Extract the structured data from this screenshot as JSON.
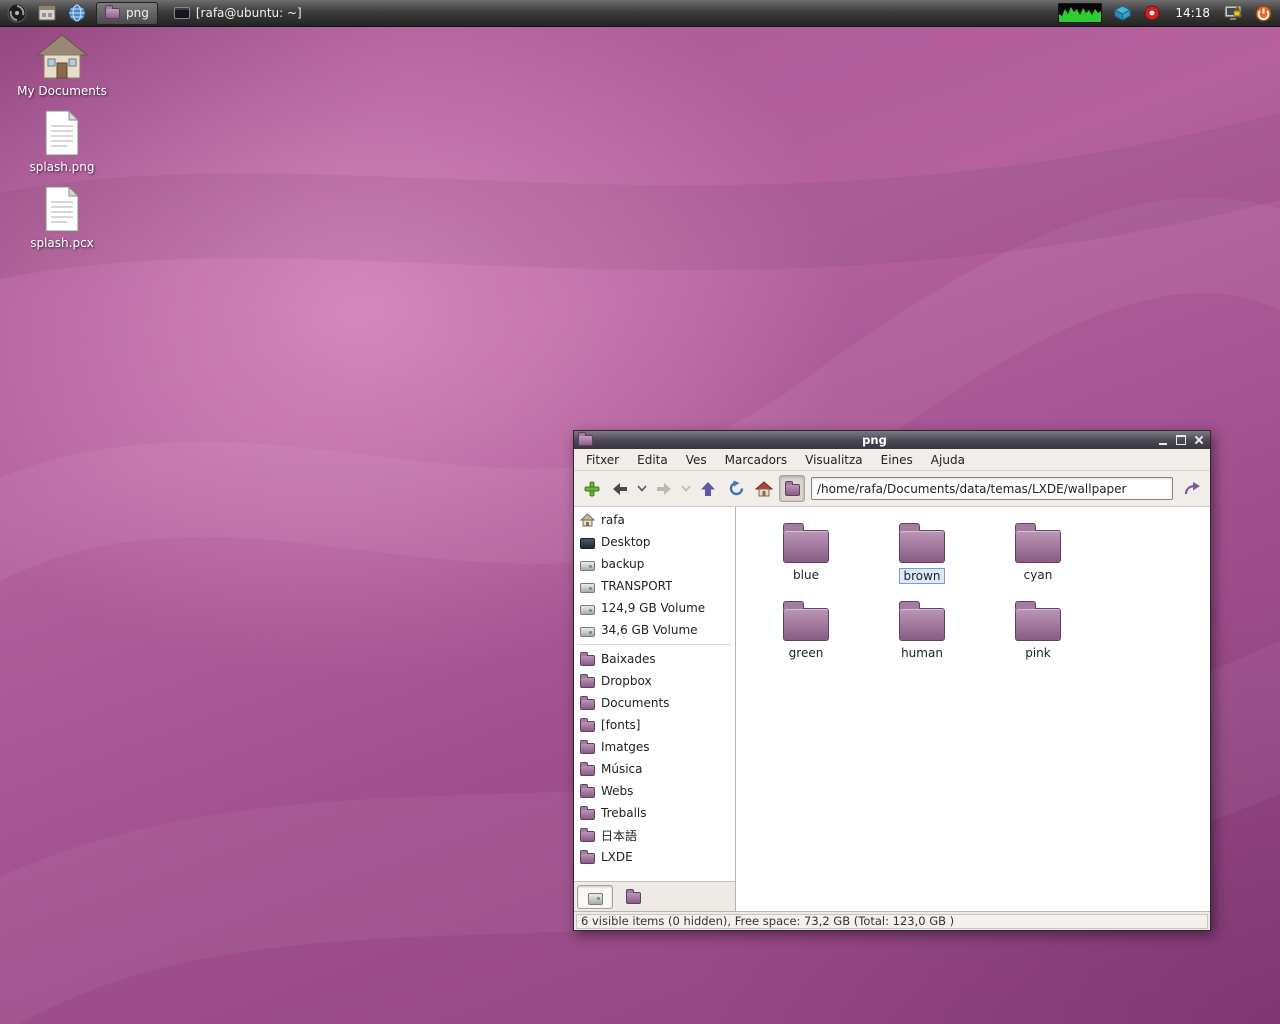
{
  "panel": {
    "tasks": [
      {
        "label": "png"
      },
      {
        "label": "[rafa@ubuntu: ~]"
      }
    ],
    "clock": "14:18"
  },
  "desktop": {
    "icons": [
      {
        "label": "My Documents"
      },
      {
        "label": "splash.png"
      },
      {
        "label": "splash.pcx"
      }
    ]
  },
  "window": {
    "title": "png",
    "menu": [
      "Fitxer",
      "Edita",
      "Ves",
      "Marcadors",
      "Visualitza",
      "Eines",
      "Ajuda"
    ],
    "toolbar": {
      "address": "/home/rafa/Documents/data/temas/LXDE/wallpaper"
    },
    "sidebar": {
      "places": [
        "rafa",
        "Desktop",
        "backup",
        "TRANSPORT",
        "124,9 GB Volume",
        "34,6 GB Volume"
      ],
      "folders": [
        "Baixades",
        "Dropbox",
        "Documents",
        "[fonts]",
        "Imatges",
        "Música",
        "Webs",
        "Treballs",
        "日本語",
        "LXDE"
      ]
    },
    "files": [
      {
        "label": "blue"
      },
      {
        "label": "brown",
        "state": "renaming"
      },
      {
        "label": "cyan"
      },
      {
        "label": "green"
      },
      {
        "label": "human"
      },
      {
        "label": "pink"
      }
    ],
    "status": "6 visible items (0 hidden), Free space: 73,2 GB (Total: 123,0 GB )"
  },
  "icons": {
    "used": [
      "app-menu-icon",
      "file-manager-icon",
      "browser-globe-icon",
      "folder-icon",
      "terminal-icon",
      "cpu-graph",
      "package-tray-icon",
      "update-tray-icon",
      "screensaver-lock-icon",
      "power-icon",
      "new-tab-icon",
      "back-icon",
      "forward-icon",
      "up-icon",
      "reload-icon",
      "home-icon",
      "directory-icon",
      "jump-icon",
      "house-icon",
      "document-icon",
      "drive-icon"
    ]
  },
  "colors": {
    "wallpaper": "#a85492",
    "folder": "#9c6f96",
    "panel": "#3c3c3c",
    "selection": "#dce9fa"
  }
}
